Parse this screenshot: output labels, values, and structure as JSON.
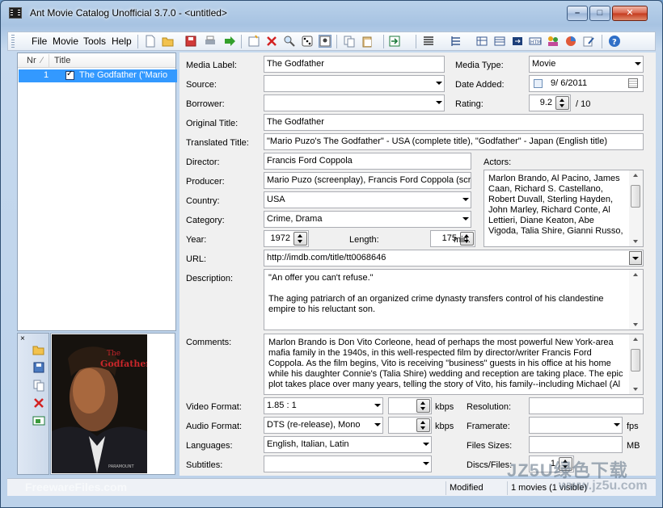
{
  "window": {
    "title": "Ant Movie Catalog Unofficial 3.7.0 - <untitled>",
    "controls": {
      "minimize": "–",
      "maximize": "□",
      "close": "✕"
    }
  },
  "menu": {
    "items": [
      "File",
      "Movie",
      "Tools",
      "Help"
    ]
  },
  "toolbar": {
    "icons": [
      "new-icon",
      "open-icon",
      "save-icon",
      "print-icon",
      "arrow-right-icon",
      "add-movie-icon",
      "delete-icon",
      "find-icon",
      "random-icon",
      "picture-icon",
      "copy-icon",
      "paste-icon",
      "import-icon",
      "list-view-icon",
      "group-icon",
      "grid-icon",
      "table-icon",
      "export-icon",
      "html-icon",
      "people-icon",
      "stats-icon",
      "edit-icon",
      "help-icon"
    ]
  },
  "movie_list": {
    "columns": [
      "Nr",
      "Title"
    ],
    "rows": [
      {
        "nr": "1",
        "title": "The Godfather (\"Mario",
        "checked": true
      }
    ]
  },
  "form": {
    "labels": {
      "media_label": "Media Label:",
      "media_type": "Media Type:",
      "source": "Source:",
      "date_added": "Date Added:",
      "borrower": "Borrower:",
      "rating": "Rating:",
      "original_title": "Original Title:",
      "translated_title": "Translated Title:",
      "director": "Director:",
      "actors": "Actors:",
      "producer": "Producer:",
      "country": "Country:",
      "category": "Category:",
      "year": "Year:",
      "length": "Length:",
      "url": "URL:",
      "description": "Description:",
      "comments": "Comments:",
      "video_format": "Video Format:",
      "resolution": "Resolution:",
      "audio_format": "Audio Format:",
      "framerate": "Framerate:",
      "languages": "Languages:",
      "file_sizes": "Files Sizes:",
      "subtitles": "Subtitles:",
      "discs_files": "Discs/Files:"
    },
    "values": {
      "media_label": "The Godfather",
      "media_type": "Movie",
      "source": "",
      "date_added": "9/ 6/2011",
      "borrower": "",
      "rating": "9.2",
      "rating_max": "/ 10",
      "original_title": "The Godfather",
      "translated_title": "\"Mario Puzo's The Godfather\" - USA (complete title),      \"Godfather\" - Japan (English title)",
      "director": "Francis Ford Coppola",
      "actors": "Marlon Brando, Al Pacino, James Caan, Richard S. Castellano, Robert Duvall, Sterling Hayden, John Marley, Richard Conte, Al Lettieri, Diane Keaton, Abe Vigoda, Talia Shire, Gianni Russo,",
      "producer": "Mario Puzo (screenplay), Francis Ford Coppola (scre",
      "country": "USA",
      "category": "Crime, Drama",
      "year": "1972",
      "length": "175",
      "length_unit": "min.",
      "url": "http://imdb.com/title/tt0068646",
      "description_line1": "\"An offer you can't refuse.\"",
      "description_line2": "The aging patriarch of an organized crime dynasty transfers control of his clandestine empire to his reluctant son.",
      "comments": "Marlon Brando is Don Vito Corleone, head of perhaps the most powerful New York-area mafia family in the 1940s, in this well-respected film by director/writer Francis Ford Coppola. As the film begins, Vito is receiving \"business\" guests in his office at his home while his daughter Connie's (Talia Shire) wedding and reception are taking place. The epic plot takes place over many years, telling the story of Vito, his family--including Michael (Al",
      "video_format": "1.85 : 1",
      "video_bitrate": "",
      "kbps": "kbps",
      "resolution": "",
      "audio_format": "DTS (re-release), Mono",
      "audio_bitrate": "",
      "framerate": "",
      "fps": "fps",
      "languages": "English, Italian, Latin",
      "file_sizes": "",
      "mb": "MB",
      "subtitles": "",
      "discs_files": "1"
    }
  },
  "poster": {
    "title": "The Godfather",
    "colors": {
      "bg": "#1a1a14",
      "title": "#c8262a"
    }
  },
  "status": {
    "state": "Modified",
    "count": "1 movies (1 visible)"
  },
  "watermarks": {
    "left": "FreewareFiles.com",
    "right": "JZ5U绿色下载",
    "right_url": "www.jz5u.com"
  }
}
